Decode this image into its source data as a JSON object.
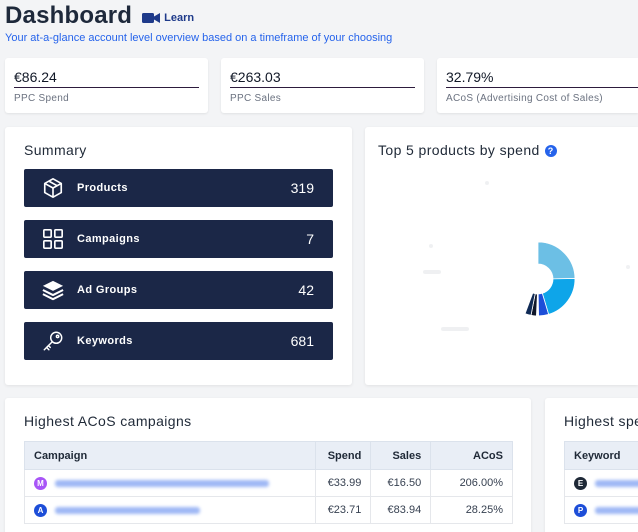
{
  "header": {
    "title": "Dashboard",
    "learn_label": "Learn",
    "subtitle": "Your at-a-glance account level overview based on a timeframe of your choosing"
  },
  "kpis": [
    {
      "value": "€86.24",
      "label": "PPC Spend"
    },
    {
      "value": "€263.03",
      "label": "PPC Sales"
    },
    {
      "value": "32.79%",
      "label": "ACoS (Advertising Cost of Sales)"
    }
  ],
  "summary": {
    "title": "Summary",
    "rows": [
      {
        "label": "Products",
        "count": "319",
        "icon": "cube-icon"
      },
      {
        "label": "Campaigns",
        "count": "7",
        "icon": "grid-icon"
      },
      {
        "label": "Ad Groups",
        "count": "42",
        "icon": "layers-icon"
      },
      {
        "label": "Keywords",
        "count": "681",
        "icon": "key-icon"
      }
    ]
  },
  "top_products": {
    "title": "Top 5 products by spend",
    "help_icon": "?"
  },
  "acos_campaigns": {
    "title": "Highest ACoS campaigns",
    "columns": [
      "Campaign",
      "Spend",
      "Sales",
      "ACoS"
    ],
    "rows": [
      {
        "badge": "M",
        "badge_color": "#a855f7",
        "spend": "€33.99",
        "sales": "€16.50",
        "acos": "206.00%",
        "acos_color": "#dc2626"
      },
      {
        "badge": "A",
        "badge_color": "#1d4ed8",
        "spend": "€23.71",
        "sales": "€83.94",
        "acos": "28.25%",
        "acos_color": "#16a34a"
      }
    ]
  },
  "highest_spend": {
    "title": "Highest spe",
    "columns": [
      "Keyword"
    ],
    "rows": [
      {
        "badge": "E",
        "badge_color": "#1f2937"
      },
      {
        "badge": "P",
        "badge_color": "#1d4ed8"
      }
    ]
  },
  "colors": {
    "navy": "#1b2747",
    "accent": "#2563eb",
    "donut": [
      "#6cbfe5",
      "#0ea5e9",
      "#1d4ed8",
      "#0f172a",
      "#38bdf8"
    ]
  }
}
